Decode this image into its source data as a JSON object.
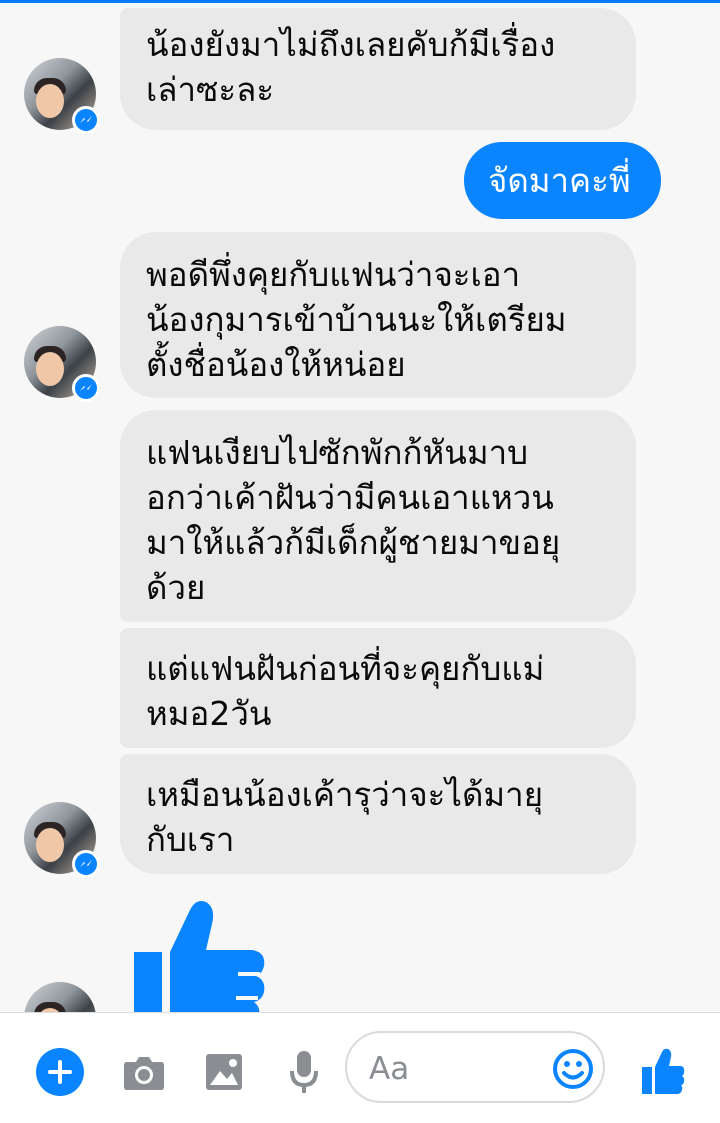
{
  "messages": [
    {
      "sender": "contact",
      "text": "น้องยังมาไม่ถึงเลยคับก้มีเรื่อง\nเล่าซะละ"
    },
    {
      "sender": "me",
      "text": "จัดมาคะพี่"
    },
    {
      "sender": "contact",
      "text": "พอดีพึ่งคุยกับแฟนว่าจะเอา\nน้องกุมารเข้าบ้านนะให้เตรียม\nตั้งชื่อน้องให้หน่อย"
    },
    {
      "sender": "contact",
      "text": "แฟนเงียบไปซักพักก้หันมาบ\nอกว่าเค้าฝันว่ามีคนเอาแหวน\nมาให้แล้วก้มีเด็กผู้ชายมาขอยุ\nด้วย"
    },
    {
      "sender": "contact",
      "text": "แต่แฟนฝันก่อนที่จะคุยกับแม่\nหมอ2วัน"
    },
    {
      "sender": "contact",
      "text": "เหมือนน้องเค้ารุว่าจะได้มายุ\nกับเรา"
    },
    {
      "sender": "contact",
      "sticker": "like-thumb"
    }
  ],
  "composer": {
    "placeholder": "Aa",
    "actions": [
      "plus-icon",
      "camera-icon",
      "image-icon",
      "microphone-icon",
      "emoji-icon",
      "like-icon"
    ]
  },
  "colors": {
    "accent": "#0a84ff",
    "incoming_bubble": "#e9e9e9",
    "background": "#f7f7f7"
  }
}
